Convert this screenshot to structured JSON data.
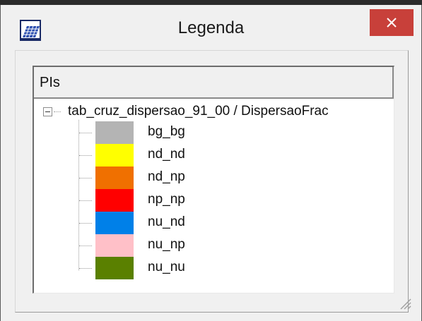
{
  "window": {
    "title": "Legenda",
    "close_glyph": "✕",
    "icon": "raster-grid-icon"
  },
  "tree": {
    "header": "PIs",
    "root_label": "tab_cruz_dispersao_91_00 / DispersaoFrac",
    "items": [
      {
        "label": "bg_bg",
        "color": "#b4b4b4"
      },
      {
        "label": "nd_nd",
        "color": "#ffff00"
      },
      {
        "label": "nd_np",
        "color": "#f07000"
      },
      {
        "label": "np_np",
        "color": "#ff0000"
      },
      {
        "label": "nu_nd",
        "color": "#0080e8"
      },
      {
        "label": "nu_np",
        "color": "#ffc0c8"
      },
      {
        "label": "nu_nu",
        "color": "#5a8000"
      }
    ]
  },
  "colors": {
    "close_button": "#c8403a",
    "window_bg": "#f0f0f0"
  }
}
